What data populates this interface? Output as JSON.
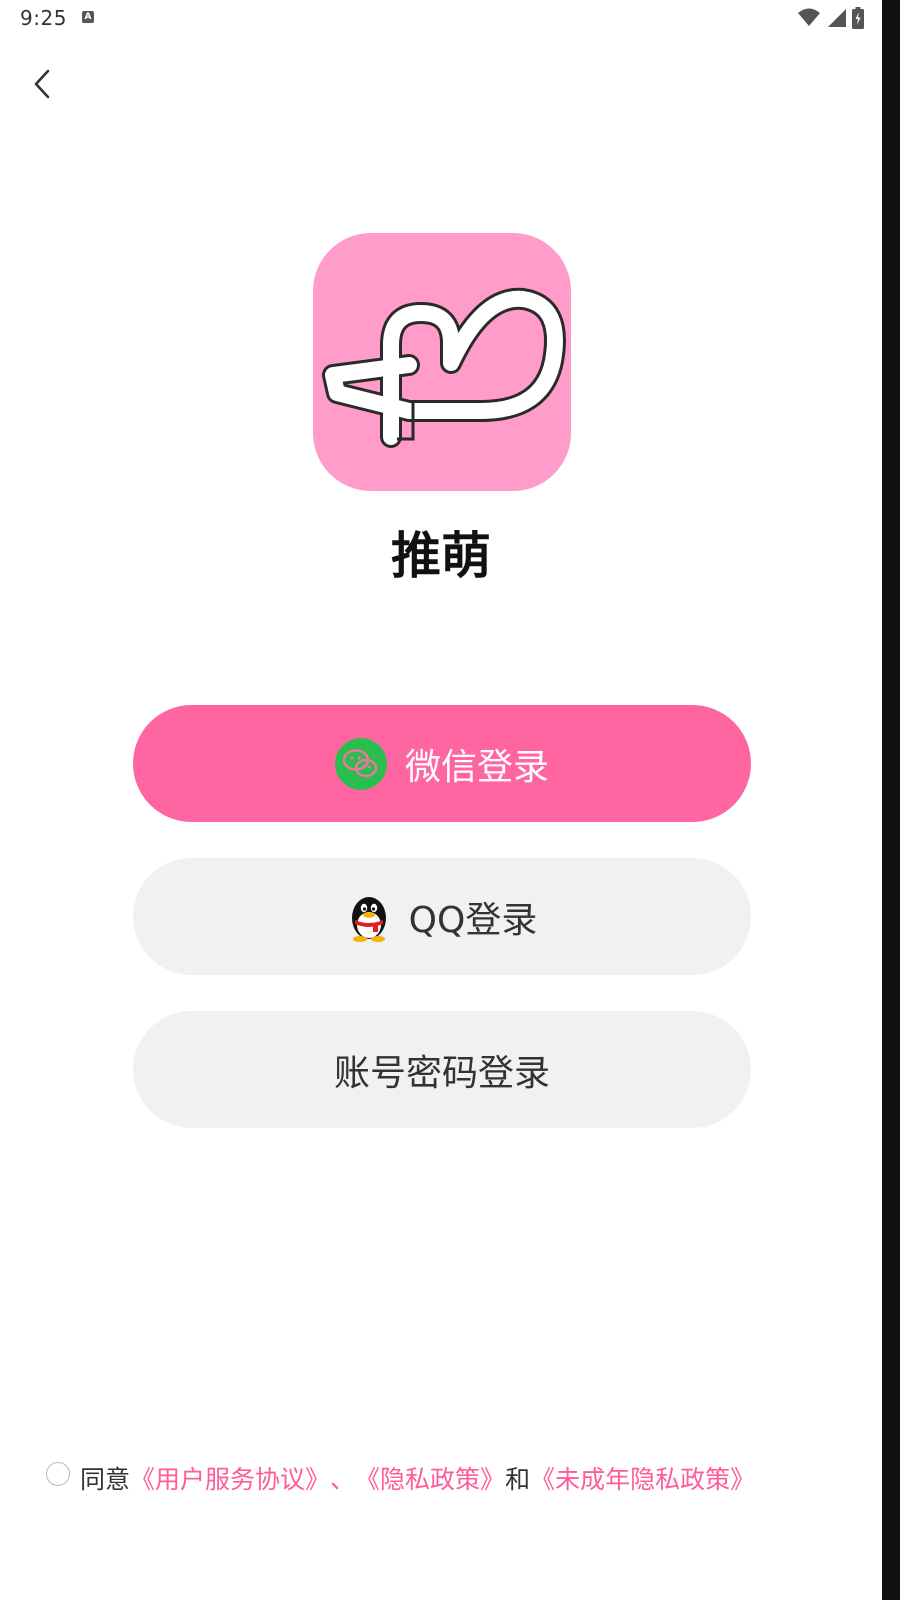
{
  "status_bar": {
    "time": "9:25",
    "notification_icon": "a-icon",
    "right_icons": [
      "wifi-icon",
      "signal-icon",
      "battery-charging-icon"
    ]
  },
  "nav": {
    "back_icon": "chevron-left-icon"
  },
  "app": {
    "logo_icon": "ribbon-logo-icon",
    "name": "推萌"
  },
  "buttons": {
    "wechat": {
      "label": "微信登录",
      "icon": "wechat-icon"
    },
    "qq": {
      "label": "QQ登录",
      "icon": "qq-penguin-icon"
    },
    "account": {
      "label": "账号密码登录"
    }
  },
  "agreement": {
    "prefix": "同意",
    "link_service": "《用户服务协议》",
    "sep": "、",
    "link_privacy": "《隐私政策》",
    "conj": "和",
    "link_minor": "《未成年隐私政策》"
  },
  "colors": {
    "accent_pink": "#ff66a1",
    "logo_bg": "#ff9cc9",
    "link_pink": "#ff5c9a",
    "secondary_button_bg": "#f1f1f1",
    "wechat_green": "#2bbd4d"
  }
}
